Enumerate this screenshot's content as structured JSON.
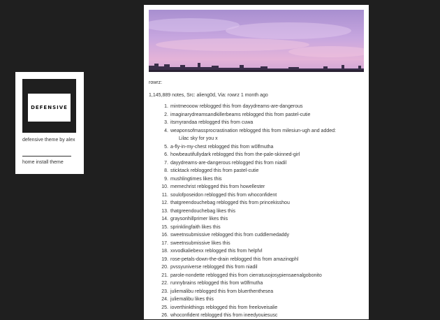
{
  "sidebar": {
    "logo_text": "DEFENSIVE",
    "theme_line": "defensive theme by alex",
    "links": [
      "home",
      "install theme"
    ]
  },
  "post": {
    "caption": "rowrz:",
    "notes_count": "1,145,889 notes,",
    "src_label": "Src:",
    "src_user": "alieng0d,",
    "via_label": "Via:",
    "via_user": "rowrz",
    "time": "1 month ago"
  },
  "notes": [
    {
      "n": "1.",
      "text": "mintmeooow reblogged this from dayydreams-are-dangerous"
    },
    {
      "n": "2.",
      "text": "imaginarydreamsandkillerbeams reblogged this from pastel-cutie"
    },
    {
      "n": "3.",
      "text": "itsmyrandaa reblogged this from cuwa"
    },
    {
      "n": "4.",
      "text": "weaponsofmassprocrastination reblogged this from milesiun-ugh and added:"
    },
    {
      "n": "",
      "text": "Lilac sky for you x",
      "added": true
    },
    {
      "n": "5.",
      "text": "a-fly-in-my-chest reblogged this from w0lfmutha"
    },
    {
      "n": "6.",
      "text": "howbeautifullydark reblogged this from the-pale-skinned-girl"
    },
    {
      "n": "7.",
      "text": "dayydreams-are-dangerous reblogged this from niadil"
    },
    {
      "n": "8.",
      "text": "sticktack reblogged this from pastel-cutie"
    },
    {
      "n": "9.",
      "text": "mushlingtimes likes this"
    },
    {
      "n": "10.",
      "text": "memechrist reblogged this from howellester"
    },
    {
      "n": "11.",
      "text": "soulofposeidon reblogged this from whoconfident"
    },
    {
      "n": "12.",
      "text": "thatgreendouchebag reblogged this from princekisshou"
    },
    {
      "n": "13.",
      "text": "thatgreendouchebag likes this"
    },
    {
      "n": "14.",
      "text": "graysonhillprimer likes this"
    },
    {
      "n": "15.",
      "text": "sprinklingfaith likes this"
    },
    {
      "n": "16.",
      "text": "sweetnsubmissive reblogged this from cuddlemedaddy"
    },
    {
      "n": "17.",
      "text": "sweetnsubmissive likes this"
    },
    {
      "n": "18.",
      "text": "xxvodkaliebexx reblogged this from helpfvl"
    },
    {
      "n": "19.",
      "text": "rose-petals-down-the-drain reblogged this from amazinqphl"
    },
    {
      "n": "20.",
      "text": "pvssyuniverse reblogged this from niadil"
    },
    {
      "n": "21.",
      "text": "parole-nondette reblogged this from cierratusojosypiensaenalgobonito"
    },
    {
      "n": "22.",
      "text": "runnybrains reblogged this from w0lfmutha"
    },
    {
      "n": "23.",
      "text": "juliemalibu reblogged this from bluerthenthesea"
    },
    {
      "n": "24.",
      "text": "juliemalibu likes this"
    },
    {
      "n": "25.",
      "text": "ioverthinkthings reblogged this from freeloveisalie"
    },
    {
      "n": "26.",
      "text": "whoconfident reblogged this from ineedyouiesusc"
    }
  ],
  "colors": {
    "page_bg": "#1f1f1f",
    "panel_bg": "#ffffff",
    "text": "#333333",
    "sky_top": "#b79ad8",
    "sky_bottom": "#e6b4d6"
  }
}
